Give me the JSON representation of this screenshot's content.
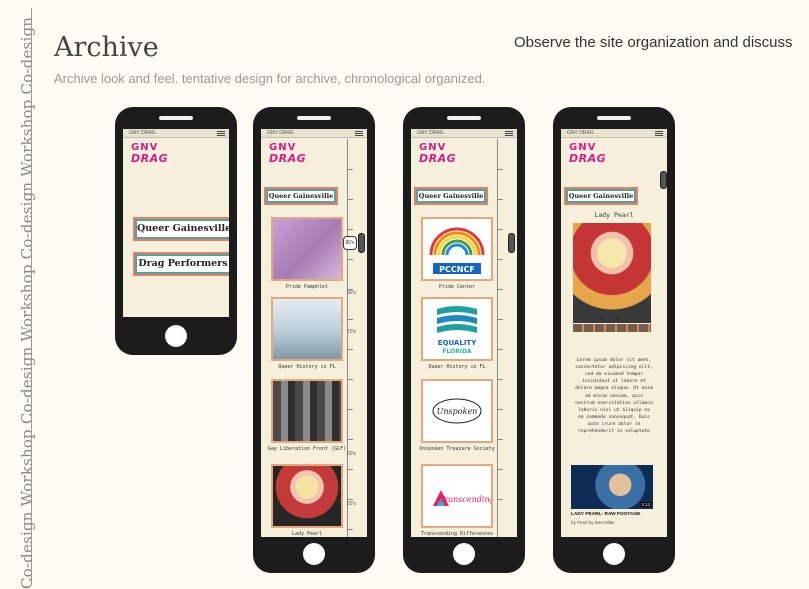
{
  "side_label": "Co-design Workshop  Co-design Workshop  Co-design Workshop  Co-design",
  "title": "Archive",
  "subtitle": "Archive look and feel. tentative design for archive,  chronological organized.",
  "headline": "Observe the site organization and discuss",
  "logo": {
    "line1": "GNV",
    "line2": "DRAG"
  },
  "phone1": {
    "buttons": [
      "Queer Gainesville",
      "Drag Performers"
    ]
  },
  "phone2": {
    "chip": "Queer Gainesville",
    "selected_decade": "80's",
    "decades": [
      "90's",
      "70's",
      "60's",
      "50's"
    ],
    "cards": [
      {
        "caption": "Pride Pamphlet",
        "image": "purple-photo"
      },
      {
        "caption": "Queer History in FL",
        "image": "dance-book-cover"
      },
      {
        "caption": "Gay Liberation Front (GLF)",
        "image": "protest-signs-photo"
      },
      {
        "caption": "Lady Pearl",
        "image": "lady-pearl-photo"
      }
    ]
  },
  "phone3": {
    "chip": "Queer Gainesville",
    "cards": [
      {
        "caption": "Pride Center",
        "logo_text": "PCCNCF"
      },
      {
        "caption": "Queer History in FL",
        "logo_text": "EQUALITY FLORIDA"
      },
      {
        "caption": "Unspoken Treasure Society",
        "logo_text": "Unspoken"
      },
      {
        "caption": "Transcending Differences",
        "logo_text": "Transcending"
      }
    ]
  },
  "phone4": {
    "chip": "Queer Gainesville",
    "name": "Lady Pearl",
    "bio": "Lorem ipsum dolor sit amet, consectetur adipiscing elit, sed do eiusmod tempor incididunt ut labore et dolore magna aliqua. Ut enim ad minim veniam, quis nostrud exercitation ullamco laboris nisi ut aliquip ex ea commodo consequat. Duis aute irure dolor in reprehenderit in voluptate",
    "video_title": "LADY PEARL: RAW FOOTAGE",
    "video_sub": "by Pearl by Bea Miller",
    "video_duration": "3:12"
  },
  "colors": {
    "pink": "#d81b8a",
    "teal": "#4fa3a5",
    "coral": "#e87f5e",
    "screen": "#f6efdb"
  }
}
